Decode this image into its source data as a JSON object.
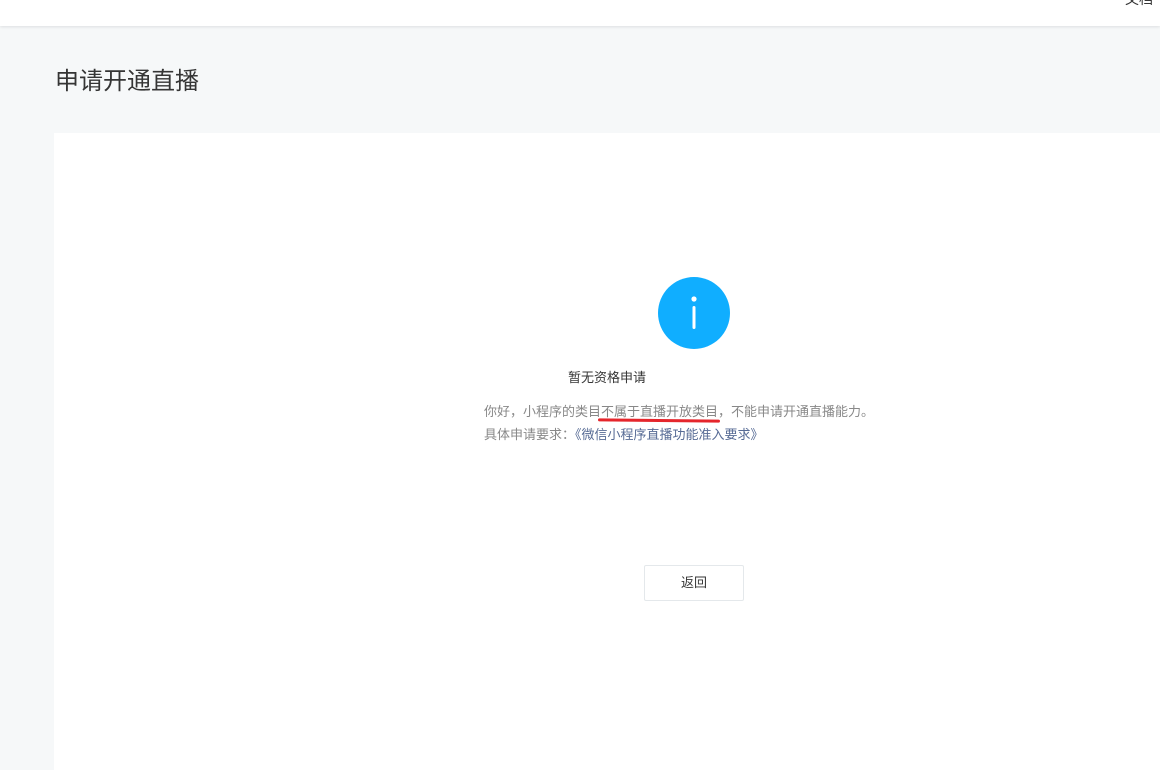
{
  "topbar": {
    "link_label": "文档"
  },
  "page": {
    "title": "申请开通直播"
  },
  "result": {
    "icon": "info-icon",
    "title": "暂无资格申请",
    "message_prefix": "你好，小程序的类目",
    "message_highlight": "不属于直播开放类目",
    "message_suffix": "，不能申请开通直播能力。",
    "requirement_label": "具体申请要求：",
    "requirement_link": "《微信小程序直播功能准入要求》",
    "back_label": "返回"
  },
  "colors": {
    "icon_blue": "#10aeff",
    "link": "#576b95",
    "highlight_underline": "#e5262c"
  }
}
